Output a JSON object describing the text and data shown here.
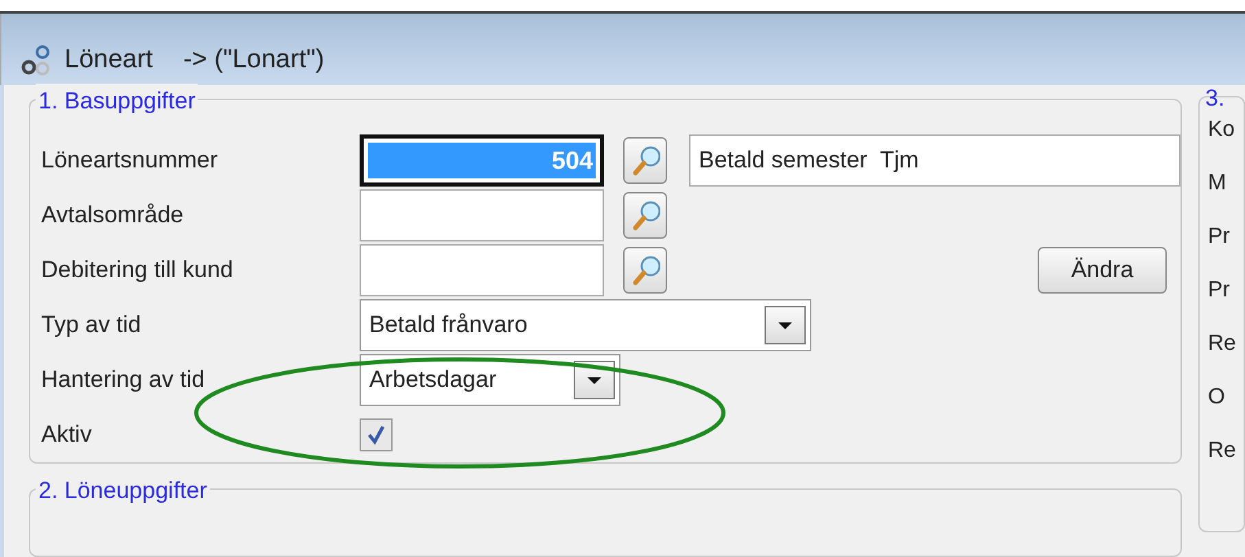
{
  "window": {
    "title": "Löneart",
    "subtitle": "-> (\"Lonart\")"
  },
  "group_1": {
    "title": "1. Basuppgifter",
    "fields": [
      {
        "kind": "lookup",
        "label": "Löneartsnummer",
        "value": "504",
        "selected": true,
        "description": "Betald semester  Tjm"
      },
      {
        "kind": "lookup",
        "label": "Avtalsområde",
        "selected": false
      },
      {
        "kind": "lookup",
        "label": "Debitering till kund",
        "selected": false,
        "button": "Ändra"
      },
      {
        "kind": "combo",
        "label": "Typ av tid",
        "value": "Betald frånvaro",
        "wide": true
      },
      {
        "kind": "combo",
        "label": "Hantering av tid",
        "value": "Arbetsdagar",
        "wide": false
      },
      {
        "kind": "checkbox",
        "label": "Aktiv",
        "checked": true
      }
    ]
  },
  "group_2": {
    "title": "2. Löneuppgifter"
  },
  "group_3": {
    "title": "3.",
    "items": [
      "Ko",
      "M",
      "Pr",
      "Pr",
      "Re",
      "O",
      "Re"
    ]
  }
}
